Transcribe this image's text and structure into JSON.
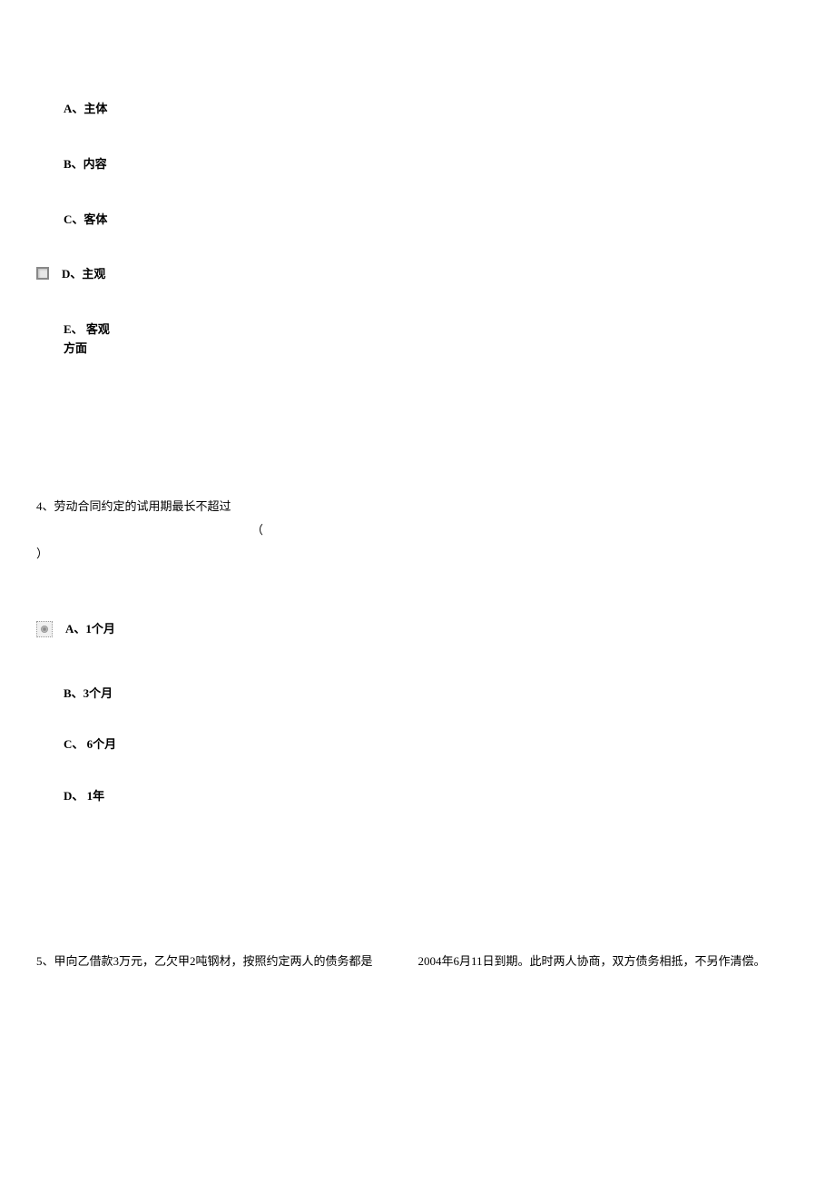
{
  "q3_options": {
    "a": "A、主体",
    "b": "B、内容",
    "c": "C、客体",
    "d": "D、主观",
    "e_line1": "E、 客观",
    "e_line2": "方面"
  },
  "q4": {
    "number_text": "4、劳动合同约定的试用期最长不超过",
    "paren_open": "（",
    "paren_close": "）",
    "options": {
      "a": "A、1个月",
      "b": "B、3个月",
      "c": "C、 6个月",
      "d": "D、 1年"
    }
  },
  "q5": {
    "part1": "5、甲向乙借款3万元，乙欠甲2吨钢材，按照约定两人的债务都是",
    "part2": "2004年6月11日到期。此时两人协商，双方债务相抵，不另作清偿。"
  }
}
